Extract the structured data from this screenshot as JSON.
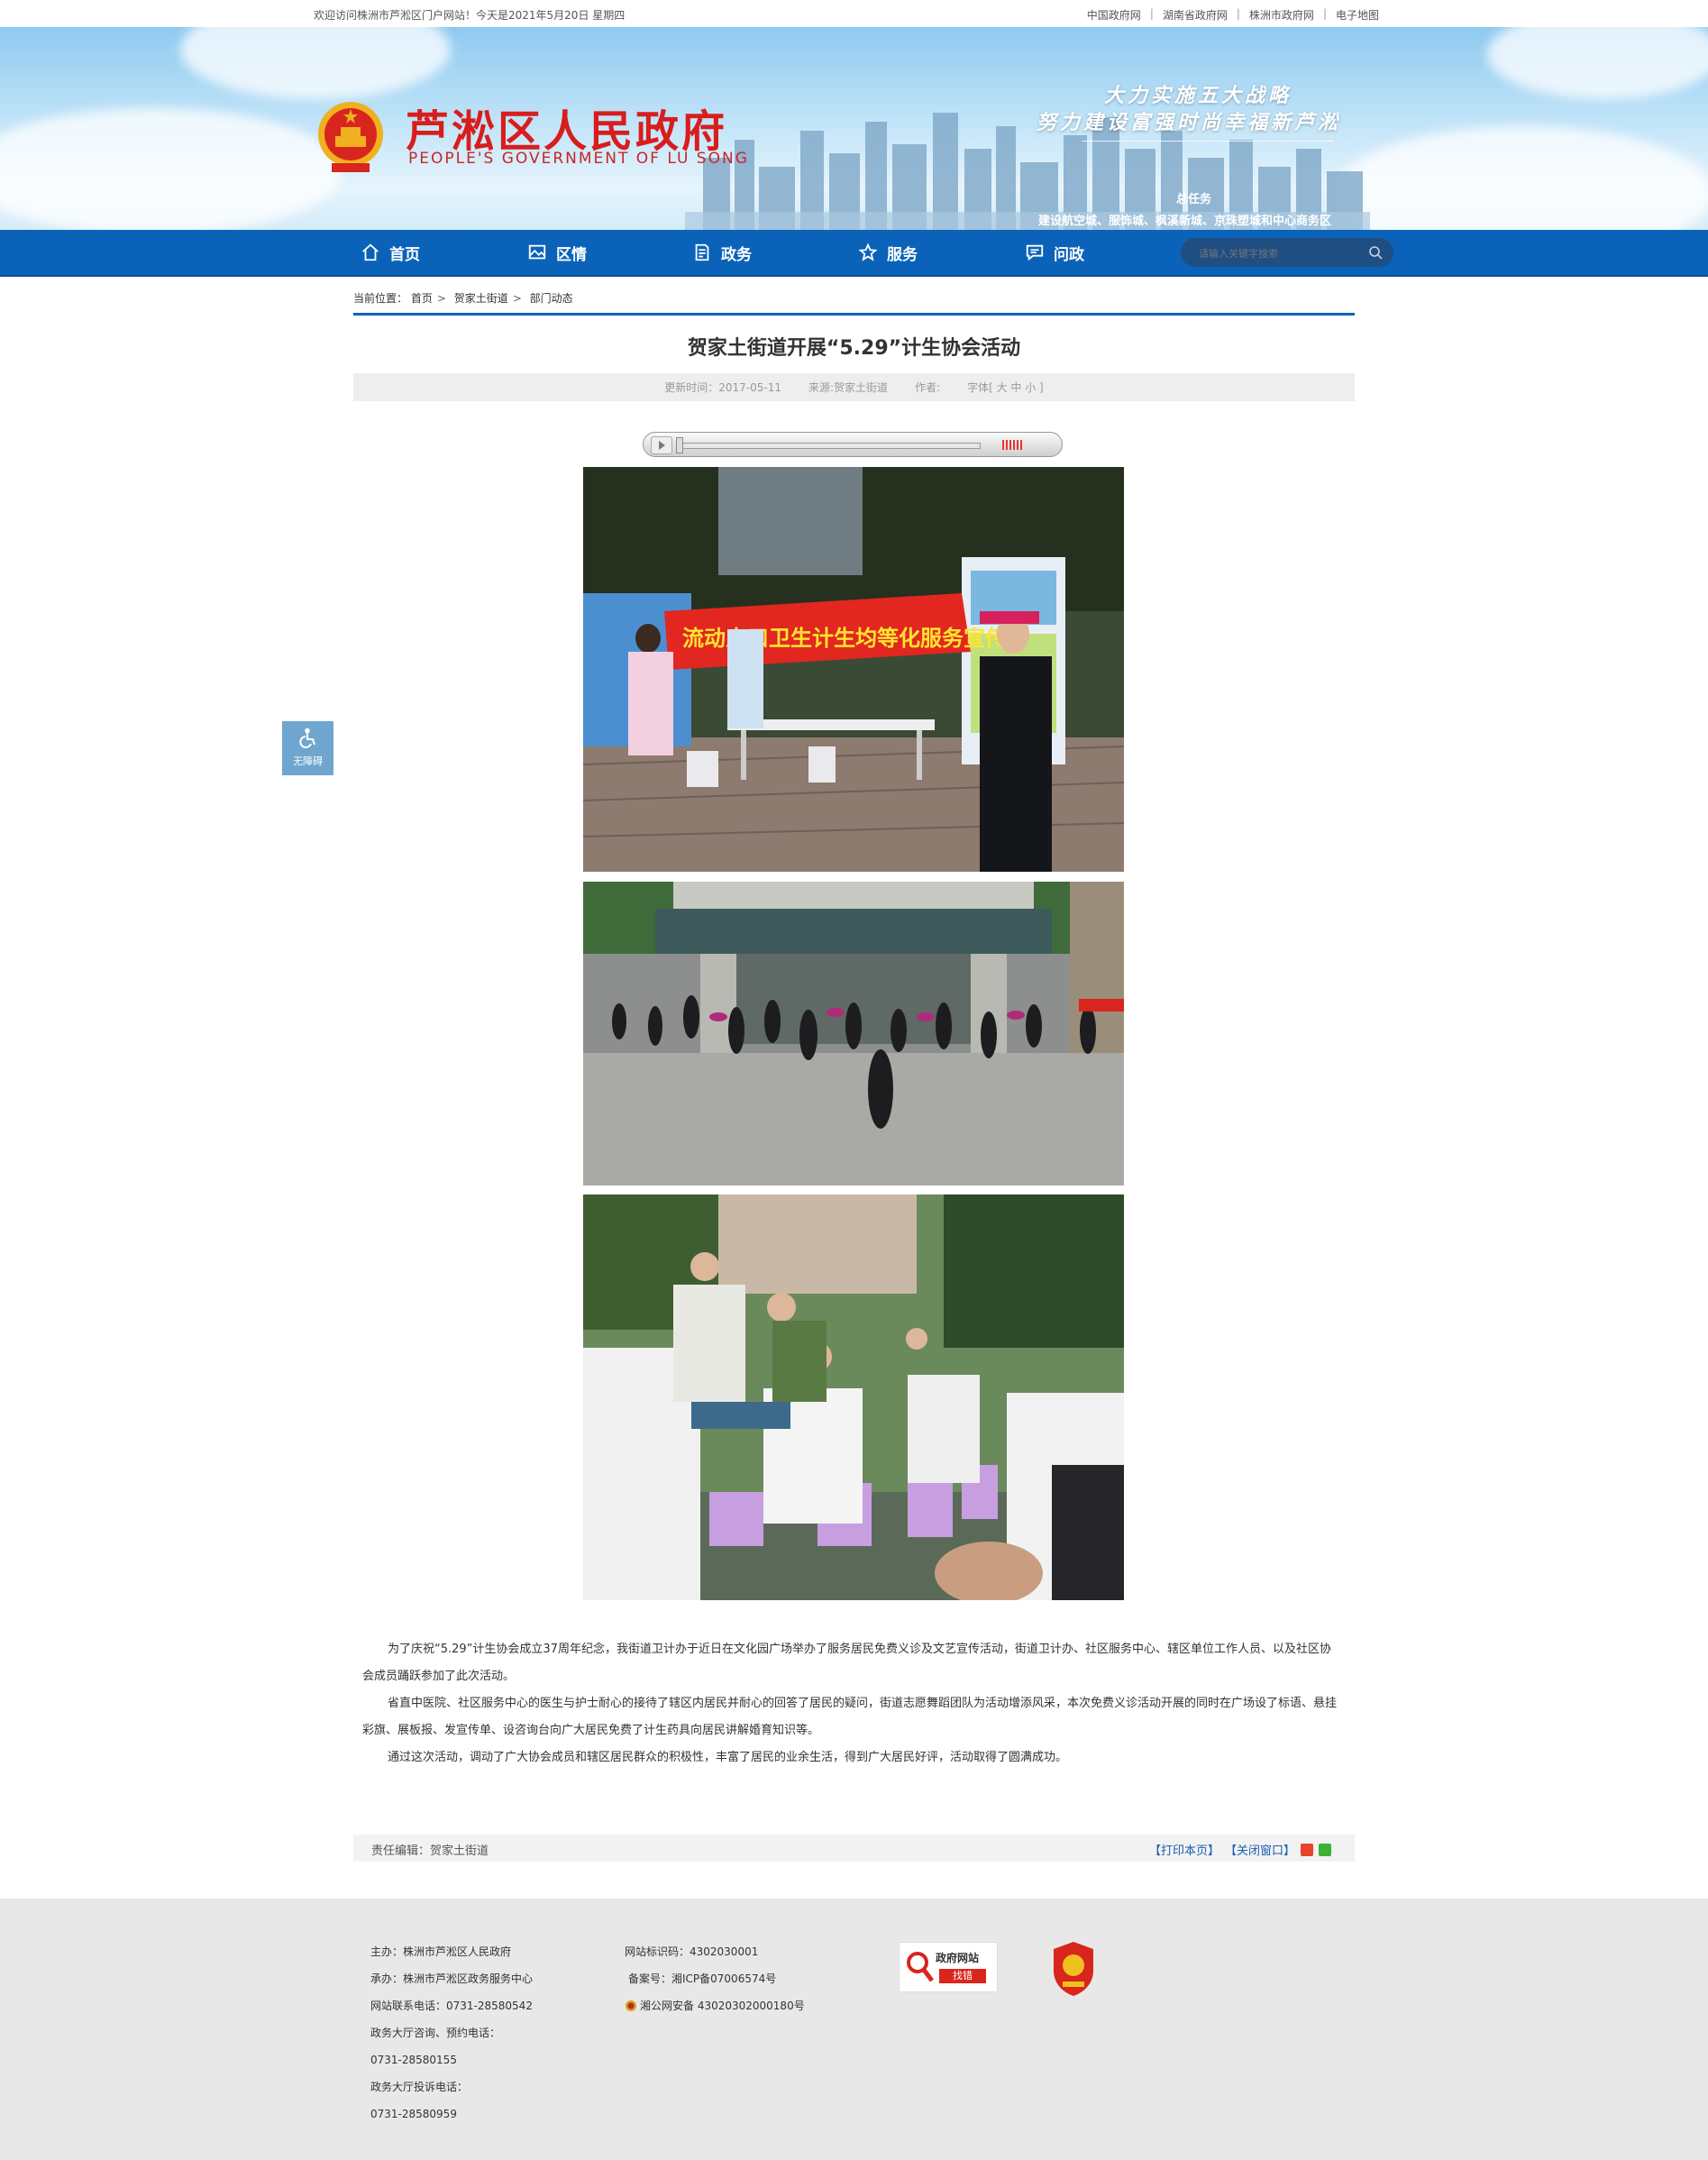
{
  "topbar": {
    "welcome": "欢迎访问株洲市芦淞区门户网站！今天是2021年5月20日 星期四",
    "links": [
      "中国政府网",
      "湖南省政府网",
      "株洲市政府网",
      "电子地图"
    ]
  },
  "banner": {
    "site_title": "芦淞区人民政府",
    "site_subtitle": "PEOPLE'S GOVERNMENT OF  LU SONG",
    "slogan_line1": "大力实施五大战略",
    "slogan_line2": "努力建设富强时尚幸福新芦淞",
    "task_label": "总任务",
    "task_text": "建设航空城、服饰城、枫溪新城、京珠塑城和中心商务区"
  },
  "nav": {
    "items": [
      {
        "label": "首页",
        "icon": "home-icon"
      },
      {
        "label": "区情",
        "icon": "image-icon"
      },
      {
        "label": "政务",
        "icon": "document-icon"
      },
      {
        "label": "服务",
        "icon": "star-icon"
      },
      {
        "label": "问政",
        "icon": "chat-icon"
      }
    ],
    "search_placeholder": "请输入关键字搜索"
  },
  "accessibility": {
    "label": "无障碍"
  },
  "breadcrumb": {
    "prefix": "当前位置：",
    "items": [
      "首页",
      "贺家土街道",
      "部门动态"
    ]
  },
  "article": {
    "title": "贺家土街道开展“5.29”计生协会活动",
    "update_time": "更新时间：2017-05-11",
    "source": "来源:贺家土街道",
    "author": "作者:",
    "font_size": "字体[ 大 中 小 ]",
    "photos": [
      {
        "description": "volunteers-banner-photo",
        "banner_text": "流动人口卫生计生均等化服务宣传"
      },
      {
        "description": "dance-performance-photo"
      },
      {
        "description": "free-clinic-photo"
      }
    ],
    "paragraphs": [
      "为了庆祝“5.29”计生协会成立37周年纪念，我街道卫计办于近日在文化园广场举办了服务居民免费义诊及文艺宣传活动，街道卫计办、社区服务中心、辖区单位工作人员、以及社区协会成员踊跃参加了此次活动。",
      "省直中医院、社区服务中心的医生与护士耐心的接待了辖区内居民并耐心的回答了居民的疑问，街道志愿舞蹈团队为活动增添风采，本次免费义诊活动开展的同时在广场设了标语、悬挂彩旗、展板报、发宣传单、设咨询台向广大居民免费了计生药具向居民讲解婚育知识等。",
      "通过这次活动，调动了广大协会成员和辖区居民群众的积极性，丰富了居民的业余生活，得到广大居民好评，活动取得了圆满成功。"
    ],
    "editor": "责任编辑：贺家土街道",
    "print_label": "【打印本页】",
    "close_label": "【关闭窗口】"
  },
  "footer": {
    "col1": [
      "主办：株洲市芦淞区人民政府",
      "承办：株洲市芦淞区政务服务中心",
      "网站联系电话：0731-28580542",
      "政务大厅咨询、预约电话：",
      "0731-28580155",
      "政务大厅投诉电话：",
      "0731-28580959"
    ],
    "col2": [
      "网站标识码：4302030001",
      "备案号：湘ICP备07006574号",
      "湘公网安备 43020302000180号"
    ],
    "badge_error_title": "政府网站",
    "badge_error_action": "找错"
  },
  "colors": {
    "nav_blue": "#0a63b8",
    "title_red": "#d81d1d",
    "link_blue": "#1a5fb4",
    "footer_bg": "#e8e8e8"
  }
}
